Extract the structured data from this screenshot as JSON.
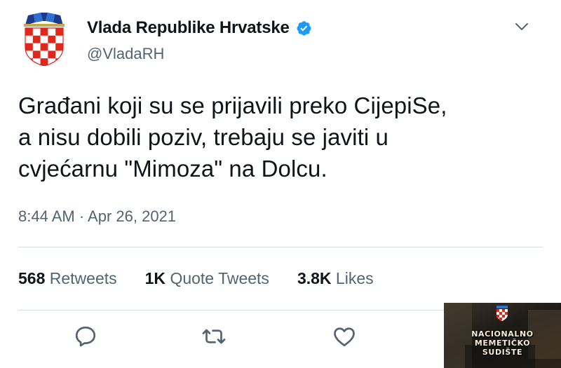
{
  "account": {
    "display_name": "Vlada Republike Hrvatske",
    "handle": "@VladaRH",
    "verified": true,
    "avatar_icon": "croatian-coat-of-arms-icon"
  },
  "tweet": {
    "text": "Građani koji su se prijavili preko CijepiSe,\na nisu dobili poziv, trebaju se javiti u\ncvjećarnu \"Mimoza\" na Dolcu.",
    "timestamp": "8:44 AM · Apr 26, 2021"
  },
  "stats": {
    "retweets_count": "568",
    "retweets_label": "Retweets",
    "quotes_count": "1K",
    "quotes_label": "Quote Tweets",
    "likes_count": "3.8K",
    "likes_label": "Likes"
  },
  "actions": {
    "reply_icon": "reply-icon",
    "retweet_icon": "retweet-icon",
    "like_icon": "heart-icon",
    "more_icon": "chevron-down-icon"
  },
  "watermark": {
    "line1": "NACIONALNO",
    "line2": "MEMETIČKO",
    "line3": "SUDIŠTE"
  },
  "colors": {
    "text_primary": "#0f1419",
    "text_secondary": "#536471",
    "verified_blue": "#1d9bf0",
    "divider": "#d6dde3",
    "checker_red": "#e1261c"
  }
}
